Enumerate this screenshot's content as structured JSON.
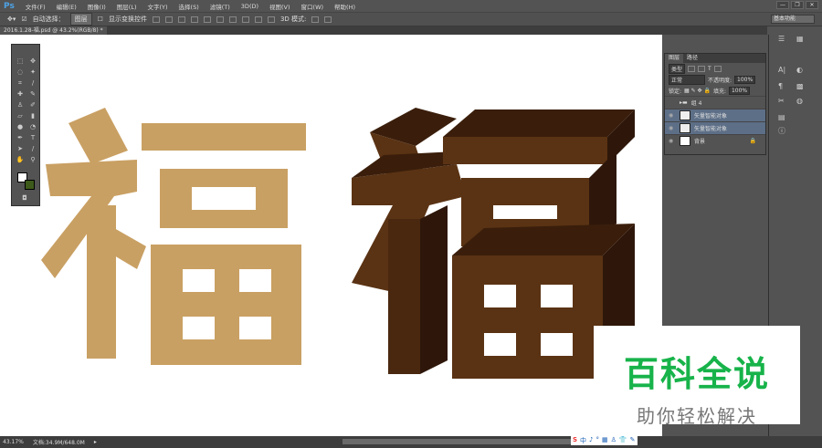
{
  "app": {
    "logo": "Ps",
    "menus": [
      "文件(F)",
      "编辑(E)",
      "图像(I)",
      "图层(L)",
      "文字(Y)",
      "选择(S)",
      "滤镜(T)",
      "3D(D)",
      "视图(V)",
      "窗口(W)",
      "帮助(H)"
    ],
    "window_buttons": [
      "—",
      "❐",
      "✕"
    ]
  },
  "options": {
    "auto_select_label": "自动选择：",
    "auto_select_value": "图层",
    "show_transform": "显示变换控件",
    "mode_3d": "3D 模式:",
    "workspace": "基本功能"
  },
  "document": {
    "tab": "2016.1.28-福.psd @ 43.2%(RGB/8) *"
  },
  "layers_panel": {
    "tabs": [
      "图层",
      "路径"
    ],
    "filter": "类型",
    "blend_mode": "正常",
    "opacity_label": "不透明度:",
    "opacity": "100%",
    "lock_label": "锁定:",
    "fill_label": "填充:",
    "fill": "100%",
    "layers": [
      {
        "name": "组 4",
        "selected": false
      },
      {
        "name": "矢量智能对象",
        "selected": true
      },
      {
        "name": "矢量智能对象",
        "selected": true
      },
      {
        "name": "背景",
        "selected": false
      }
    ]
  },
  "status": {
    "zoom": "43.17%",
    "doc_size": "文档:34.9M/648.0M"
  },
  "ime": [
    "S",
    "中",
    "♪",
    "°",
    "▦",
    "♙",
    "👕",
    "✎"
  ],
  "watermark": {
    "title": "百科全说",
    "subtitle": "助你轻松解决"
  },
  "colors": {
    "flat_glyph": "#c9a063",
    "glyph_front": "#5a3314",
    "glyph_side": "#3a1e0b",
    "watermark_green": "#17b34a"
  }
}
